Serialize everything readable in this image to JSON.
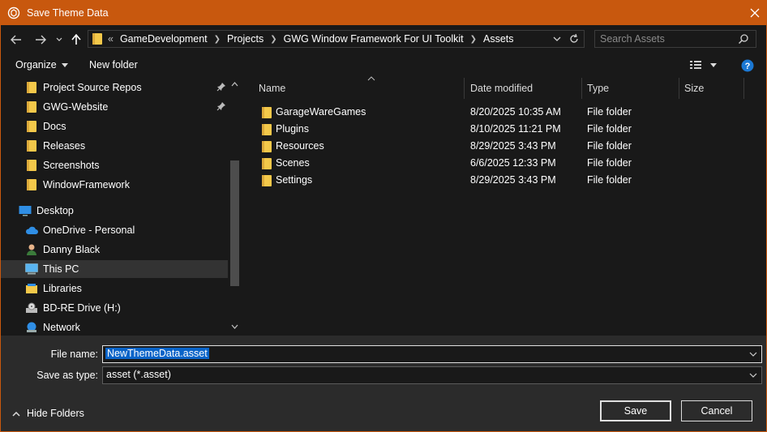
{
  "window": {
    "title": "Save Theme Data",
    "accent": "#c8580e"
  },
  "address": {
    "overflow": "«",
    "crumbs": [
      "GameDevelopment",
      "Projects",
      "GWG Window Framework For UI Toolkit",
      "Assets"
    ]
  },
  "search": {
    "placeholder": "Search Assets"
  },
  "toolbar": {
    "organize": "Organize",
    "new_folder": "New folder"
  },
  "nav": {
    "items": [
      {
        "label": "Project Source Repos",
        "icon": "folder-icon",
        "pinned": true
      },
      {
        "label": "GWG-Website",
        "icon": "folder-icon",
        "pinned": true
      },
      {
        "label": "Docs",
        "icon": "folder-icon"
      },
      {
        "label": "Releases",
        "icon": "folder-icon"
      },
      {
        "label": "Screenshots",
        "icon": "folder-icon"
      },
      {
        "label": "WindowFramework",
        "icon": "folder-icon"
      },
      {
        "label": "Desktop",
        "icon": "desktop-icon"
      },
      {
        "label": "OneDrive - Personal",
        "icon": "cloud-icon"
      },
      {
        "label": "Danny Black",
        "icon": "user-icon"
      },
      {
        "label": "This PC",
        "icon": "computer-icon",
        "selected": true
      },
      {
        "label": "Libraries",
        "icon": "libraries-icon"
      },
      {
        "label": "BD-RE Drive (H:)",
        "icon": "drive-icon"
      },
      {
        "label": "Network",
        "icon": "network-icon"
      }
    ]
  },
  "columns": {
    "name": "Name",
    "date": "Date modified",
    "type": "Type",
    "size": "Size"
  },
  "files": [
    {
      "name": "GarageWareGames",
      "date": "8/20/2025 10:35 AM",
      "type": "File folder"
    },
    {
      "name": "Plugins",
      "date": "8/10/2025 11:21 PM",
      "type": "File folder"
    },
    {
      "name": "Resources",
      "date": "8/29/2025 3:43 PM",
      "type": "File folder"
    },
    {
      "name": "Scenes",
      "date": "6/6/2025 12:33 PM",
      "type": "File folder"
    },
    {
      "name": "Settings",
      "date": "8/29/2025 3:43 PM",
      "type": "File folder"
    }
  ],
  "form": {
    "file_name_label": "File name:",
    "file_name_value": "NewThemeData.asset",
    "type_label": "Save as type:",
    "type_value": "asset (*.asset)"
  },
  "footer": {
    "hide_folders": "Hide Folders",
    "save": "Save",
    "cancel": "Cancel"
  }
}
